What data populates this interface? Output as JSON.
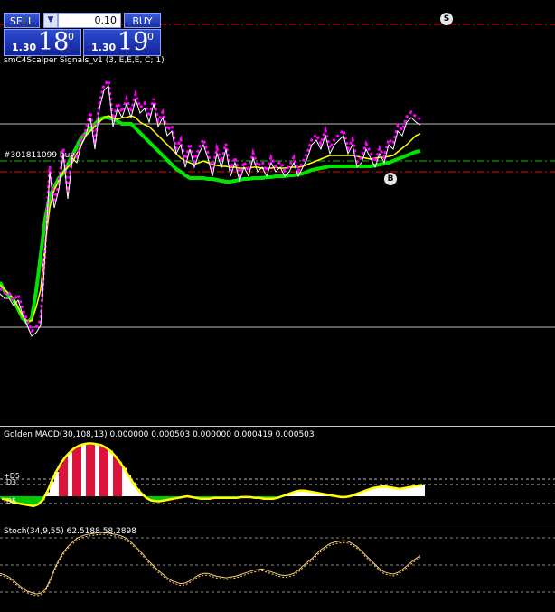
{
  "trade_panel": {
    "sell_label": "SELL",
    "buy_label": "BUY",
    "lot_value": "0.10",
    "dropdown_icon": "chevron-down-icon",
    "bid_prefix": "1.30",
    "bid_big": "18",
    "bid_sup": "0",
    "ask_prefix": "1.30",
    "ask_big": "19",
    "ask_sup": "0"
  },
  "main_indicator_label": "smC4Scalper Signals_v1 (3, E,E,E, C; 1)",
  "order_label": "#301811099 buy",
  "markers": {
    "sell": "S",
    "buy": "B"
  },
  "macd": {
    "label": "Golden MACD(30,108,13) 0.000000 0.000503 0.000000 0.000419 0.000503",
    "level_labels": [
      "+D5",
      "-D3",
      "-D5"
    ]
  },
  "stoch": {
    "label": "Stoch(34,9,55) 62.5188 58.2898"
  },
  "colors": {
    "background": "#000000",
    "price": "#ffffff",
    "green_band": "#00e600",
    "magenta_dots": "#ff00ff",
    "yellow_ma": "#ffff00",
    "sell_line": "#ff0000",
    "buy_line": "#00c800",
    "macd_red": "#dc143c",
    "macd_green": "#00c800",
    "macd_white": "#ffffff"
  },
  "chart_data": [
    {
      "type": "line",
      "title": "smC4Scalper Signals_v1 (3, E,E,E, C; 1)",
      "x": [
        0,
        5,
        10,
        15,
        20,
        25,
        30,
        35,
        40,
        45,
        50,
        55,
        60,
        65,
        70,
        75,
        80,
        85,
        90,
        95,
        100,
        105,
        110,
        115,
        120,
        125,
        130,
        135,
        140,
        145,
        150,
        155,
        160,
        165,
        170,
        175,
        180,
        185,
        190,
        195,
        200,
        205,
        210,
        215,
        220,
        225,
        230,
        235,
        240,
        245,
        250,
        255,
        260,
        265,
        270,
        275,
        280,
        285,
        290,
        295,
        300,
        305,
        310,
        315,
        320,
        325,
        330,
        335,
        340,
        345,
        350,
        355,
        360,
        365,
        370,
        375,
        380,
        385,
        390,
        395,
        400,
        405,
        410,
        415,
        420,
        425,
        430,
        435,
        440,
        445,
        450,
        455,
        460,
        465
      ],
      "series": [
        {
          "values": [
            325,
            330,
            330,
            338,
            332,
            348,
            360,
            372,
            368,
            360,
            280,
            190,
            230,
            210,
            170,
            220,
            175,
            180,
            160,
            150,
            130,
            165,
            120,
            100,
            95,
            140,
            120,
            130,
            115,
            130,
            110,
            125,
            120,
            135,
            115,
            140,
            130,
            150,
            145,
            170,
            160,
            185,
            165,
            185,
            170,
            160,
            175,
            195,
            170,
            185,
            165,
            195,
            180,
            200,
            185,
            195,
            175,
            190,
            185,
            195,
            180,
            190,
            185,
            195,
            190,
            180,
            195,
            185,
            175,
            160,
            155,
            165,
            150,
            170,
            160,
            155,
            150,
            170,
            160,
            185,
            180,
            165,
            175,
            185,
            170,
            180,
            160,
            165,
            145,
            150,
            135,
            130,
            135,
            138
          ]
        },
        {
          "values": [
            315,
            320,
            325,
            330,
            340,
            350,
            355,
            355,
            340,
            320,
            270,
            230,
            210,
            200,
            190,
            185,
            180,
            170,
            160,
            150,
            145,
            140,
            135,
            130,
            128,
            130,
            132,
            130,
            130,
            128,
            130,
            135,
            138,
            140,
            145,
            150,
            155,
            160,
            165,
            170,
            175,
            178,
            180,
            182,
            180,
            178,
            180,
            182,
            183,
            184,
            184,
            185,
            185,
            186,
            186,
            186,
            185,
            185,
            186,
            186,
            186,
            185,
            186,
            186,
            185,
            185,
            185,
            184,
            182,
            180,
            178,
            176,
            174,
            172,
            172,
            172,
            172,
            172,
            172,
            173,
            174,
            175,
            176,
            175,
            174,
            174,
            173,
            172,
            168,
            164,
            160,
            155,
            150,
            148
          ]
        },
        {
          "values": [
            300,
            310,
            315,
            320,
            330,
            340,
            345,
            340,
            310,
            270,
            230,
            205,
            195,
            185,
            180,
            170,
            160,
            150,
            140,
            135,
            130,
            125,
            120,
            118,
            118,
            120,
            122,
            125,
            125,
            125,
            130,
            135,
            140,
            145,
            150,
            155,
            160,
            165,
            170,
            175,
            178,
            182,
            185,
            185,
            185,
            185,
            186,
            186,
            187,
            188,
            189,
            189,
            188,
            187,
            186,
            186,
            185,
            185,
            185,
            184,
            184,
            183,
            183,
            183,
            182,
            182,
            181,
            180,
            178,
            176,
            175,
            174,
            173,
            172,
            172,
            172,
            172,
            172,
            172,
            172,
            172,
            172,
            172,
            171,
            170,
            169,
            168,
            166,
            164,
            162,
            160,
            158,
            156,
            155
          ]
        }
      ]
    },
    {
      "type": "line",
      "title": "Golden MACD(30,108,13)",
      "x": [
        0,
        5,
        10,
        15,
        20,
        25,
        30,
        35,
        40,
        45,
        50,
        55,
        60,
        65,
        70,
        75,
        80,
        85,
        90,
        95,
        100,
        105,
        110,
        115,
        120,
        125,
        130,
        135,
        140,
        145,
        150,
        155,
        160,
        165,
        170,
        175,
        180,
        185,
        190,
        195,
        200,
        205,
        210,
        215,
        220,
        225,
        230,
        235,
        240,
        245,
        250,
        255,
        260,
        265,
        270,
        275,
        280,
        285,
        290,
        295,
        300,
        305,
        310,
        315,
        320,
        325,
        330,
        335,
        340,
        345,
        350,
        355,
        360,
        365,
        370,
        375,
        380,
        385,
        390,
        395,
        400,
        405,
        410,
        415,
        420,
        425,
        430,
        435,
        440,
        445,
        450,
        455,
        460,
        465
      ],
      "series": [
        {
          "values": [
            -0.3,
            -0.4,
            -0.6,
            -0.8,
            -0.9,
            -1.0,
            -1.1,
            -1.2,
            -1.0,
            -0.5,
            0.5,
            1.8,
            3.0,
            4.0,
            4.8,
            5.4,
            5.9,
            6.2,
            6.4,
            6.5,
            6.5,
            6.4,
            6.3,
            6.0,
            5.6,
            5.0,
            4.3,
            3.5,
            2.6,
            1.7,
            0.9,
            0.3,
            -0.2,
            -0.5,
            -0.6,
            -0.6,
            -0.5,
            -0.4,
            -0.3,
            -0.2,
            -0.1,
            0.0,
            -0.1,
            -0.2,
            -0.3,
            -0.3,
            -0.3,
            -0.2,
            -0.2,
            -0.2,
            -0.2,
            -0.2,
            -0.2,
            -0.1,
            -0.1,
            -0.1,
            -0.2,
            -0.2,
            -0.3,
            -0.3,
            -0.3,
            -0.2,
            0.0,
            0.2,
            0.4,
            0.6,
            0.7,
            0.7,
            0.6,
            0.5,
            0.4,
            0.3,
            0.2,
            0.1,
            0.0,
            -0.1,
            -0.1,
            0.0,
            0.2,
            0.4,
            0.6,
            0.8,
            1.0,
            1.1,
            1.2,
            1.2,
            1.1,
            1.0,
            0.9,
            1.0,
            1.1,
            1.2,
            1.3,
            1.4
          ]
        }
      ]
    },
    {
      "type": "line",
      "title": "Stoch(34,9,55)",
      "x": [
        0,
        5,
        10,
        15,
        20,
        25,
        30,
        35,
        40,
        45,
        50,
        55,
        60,
        65,
        70,
        75,
        80,
        85,
        90,
        95,
        100,
        105,
        110,
        115,
        120,
        125,
        130,
        135,
        140,
        145,
        150,
        155,
        160,
        165,
        170,
        175,
        180,
        185,
        190,
        195,
        200,
        205,
        210,
        215,
        220,
        225,
        230,
        235,
        240,
        245,
        250,
        255,
        260,
        265,
        270,
        275,
        280,
        285,
        290,
        295,
        300,
        305,
        310,
        315,
        320,
        325,
        330,
        335,
        340,
        345,
        350,
        355,
        360,
        365,
        370,
        375,
        380,
        385,
        390,
        395,
        400,
        405,
        410,
        415,
        420,
        425,
        430,
        435,
        440,
        445,
        450,
        455,
        460,
        465
      ],
      "series": [
        {
          "values": [
            40,
            38,
            35,
            30,
            25,
            20,
            16,
            14,
            12,
            13,
            18,
            30,
            45,
            58,
            68,
            76,
            82,
            87,
            90,
            92,
            93,
            94,
            95,
            95,
            94,
            93,
            92,
            90,
            87,
            82,
            76,
            70,
            63,
            56,
            50,
            44,
            39,
            34,
            30,
            28,
            26,
            27,
            30,
            34,
            38,
            40,
            40,
            38,
            36,
            35,
            34,
            35,
            36,
            38,
            40,
            42,
            44,
            45,
            46,
            44,
            42,
            40,
            38,
            37,
            38,
            40,
            44,
            50,
            55,
            60,
            66,
            72,
            76,
            80,
            82,
            83,
            84,
            83,
            80,
            76,
            70,
            64,
            58,
            52,
            46,
            42,
            40,
            39,
            41,
            45,
            50,
            55,
            60,
            64
          ]
        }
      ]
    }
  ]
}
